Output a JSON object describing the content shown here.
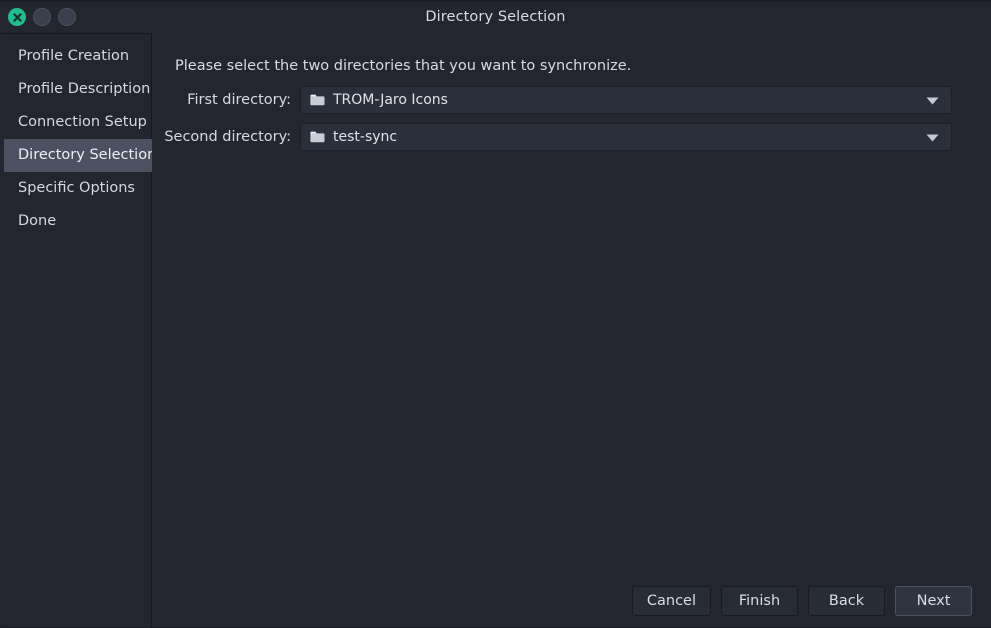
{
  "window": {
    "title": "Directory Selection",
    "controls": [
      {
        "name": "close",
        "icon": "close-icon",
        "color": "#1fbd90"
      },
      {
        "name": "minimize",
        "icon": "minimize-icon",
        "color": "#3a3f4d"
      },
      {
        "name": "maximize",
        "icon": "maximize-icon",
        "color": "#3a3f4d"
      }
    ]
  },
  "sidebar": {
    "items": [
      {
        "label": "Profile Creation",
        "selected": false
      },
      {
        "label": "Profile Description",
        "selected": false
      },
      {
        "label": "Connection Setup",
        "selected": false
      },
      {
        "label": "Directory Selection",
        "selected": true
      },
      {
        "label": "Specific Options",
        "selected": false
      },
      {
        "label": "Done",
        "selected": false
      }
    ]
  },
  "main": {
    "instruction": "Please select the two directories that you want to synchronize.",
    "fields": [
      {
        "label": "First directory:",
        "value": "TROM-Jaro Icons",
        "icon": "folder-icon",
        "arrow": "chevron-down-icon"
      },
      {
        "label": "Second directory:",
        "value": "test-sync",
        "icon": "folder-icon",
        "arrow": "chevron-down-icon"
      }
    ]
  },
  "footer": {
    "buttons": [
      {
        "label": "Cancel",
        "focused": false
      },
      {
        "label": "Finish",
        "focused": false
      },
      {
        "label": "Back",
        "focused": false
      },
      {
        "label": "Next",
        "focused": true
      }
    ]
  },
  "colors": {
    "background": "#23262f",
    "accent": "#1fbd90",
    "selection": "#4b5160",
    "field": "#2b2f3b",
    "text": "#d8dbe2"
  }
}
